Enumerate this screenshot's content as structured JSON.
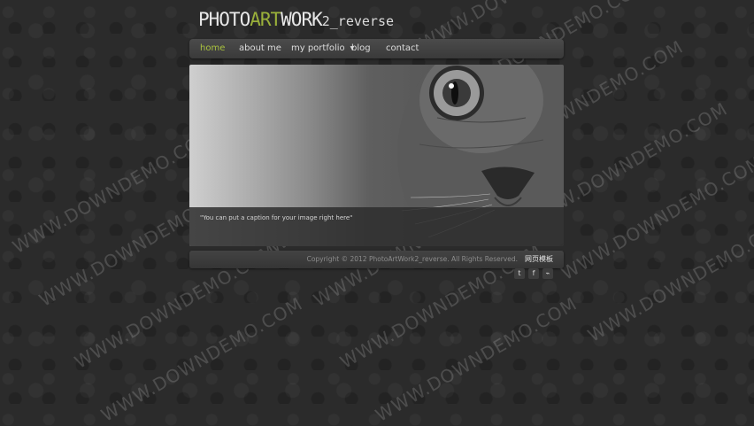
{
  "logo": {
    "part1": "PHOTO",
    "part2": "ART",
    "part3": "WORK",
    "part4": "2_reverse"
  },
  "nav": {
    "home": "home",
    "about": "about me",
    "portfolio": "my portfolio",
    "blog": "blog",
    "contact": "contact"
  },
  "slider": {
    "caption": "\"You can put a caption for your image right here\""
  },
  "footer": {
    "copyright": "Copyright © 2012 PhotoArtWork2_reverse. All Rights Reserved.",
    "link": "网页模板"
  },
  "social": {
    "twitter": "twitter-icon",
    "facebook": "facebook-icon",
    "rss": "rss-icon"
  },
  "colors": {
    "accent": "#a9c23f",
    "background": "#2b2b2b"
  },
  "watermark": "WWW.DOWNDEMO.COM"
}
